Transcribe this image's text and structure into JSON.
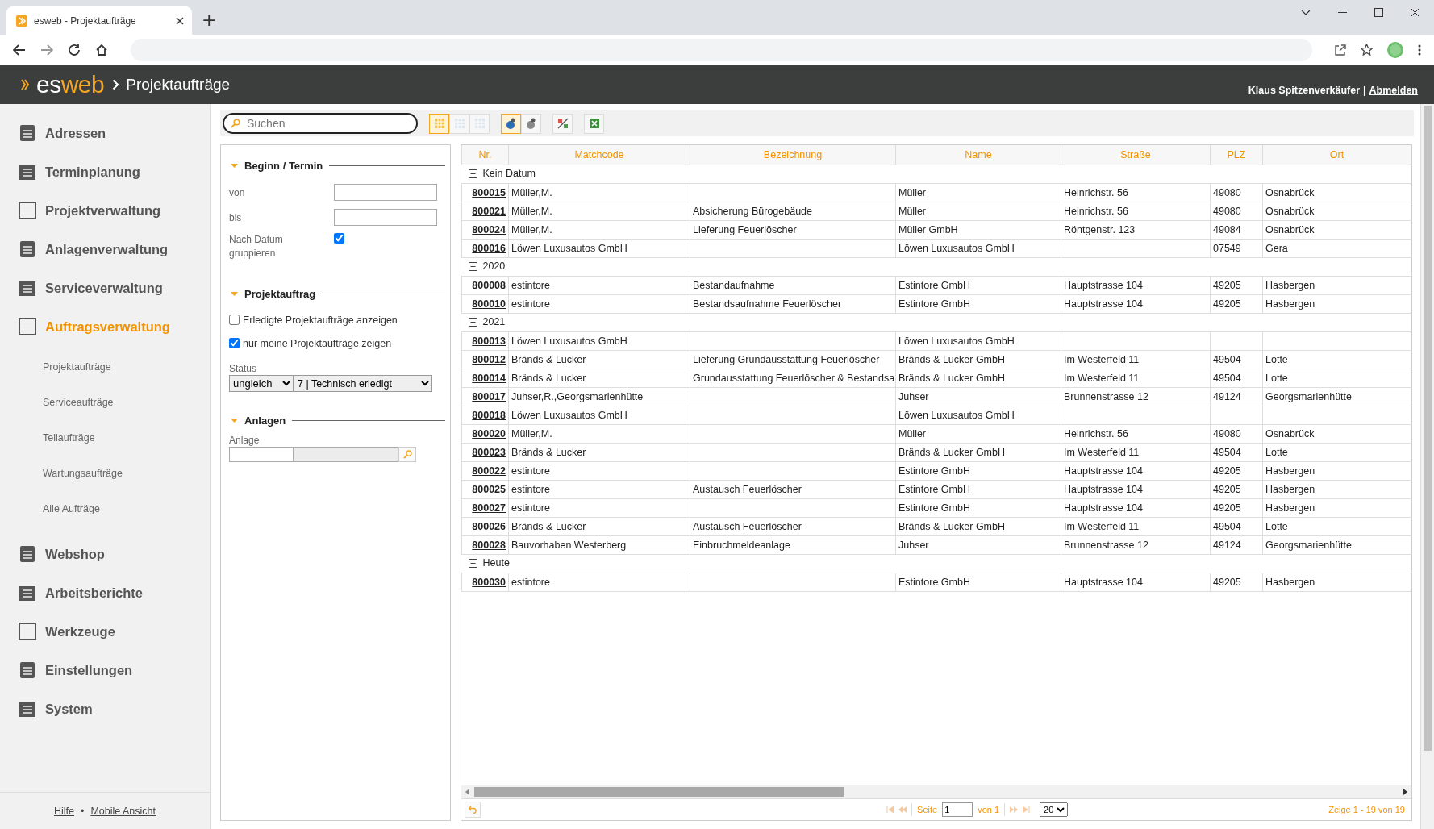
{
  "browser": {
    "tab_title": "esweb - Projektaufträge",
    "new_tab": "+"
  },
  "header": {
    "logo_first": "es",
    "logo_second": "web",
    "page_title": "Projektaufträge",
    "user": "Klaus Spitzenverkäufer",
    "separator": "|",
    "logout": "Abmelden"
  },
  "sidebar": {
    "items": [
      {
        "label": "Adressen",
        "selected": false
      },
      {
        "label": "Terminplanung",
        "selected": false
      },
      {
        "label": "Projektverwaltung",
        "selected": false
      },
      {
        "label": "Anlagenverwaltung",
        "selected": false
      },
      {
        "label": "Serviceverwaltung",
        "selected": false
      },
      {
        "label": "Auftragsverwaltung",
        "selected": true,
        "children": [
          {
            "label": "Projektaufträge",
            "selected": false
          },
          {
            "label": "Serviceaufträge",
            "selected": false
          },
          {
            "label": "Teilaufträge",
            "selected": false
          },
          {
            "label": "Wartungsaufträge",
            "selected": false
          },
          {
            "label": "Alle Aufträge",
            "selected": false
          }
        ]
      },
      {
        "label": "Webshop",
        "selected": false
      },
      {
        "label": "Arbeitsberichte",
        "selected": false
      },
      {
        "label": "Werkzeuge",
        "selected": false
      },
      {
        "label": "Einstellungen",
        "selected": false
      },
      {
        "label": "System",
        "selected": false
      }
    ],
    "footer": {
      "help": "Hilfe",
      "bullet": "•",
      "mobile": "Mobile Ansicht"
    }
  },
  "toolbar": {
    "search": {
      "placeholder": "Suchen"
    },
    "groups": [
      {
        "buttons": [
          {
            "selected": true
          },
          {
            "selected": false
          },
          {
            "selected": false
          }
        ]
      },
      {
        "buttons": [
          {
            "selected": true
          },
          {
            "selected": false
          }
        ]
      },
      {
        "buttons": [
          {
            "selected": false
          }
        ]
      },
      {
        "buttons": [
          {
            "selected": false
          }
        ]
      }
    ]
  },
  "filters": {
    "sections": [
      {
        "title": "Beginn / Termin",
        "expanded": true,
        "fields": [
          {
            "kind": "text",
            "label": "von"
          },
          {
            "kind": "text",
            "label": "bis"
          },
          {
            "kind": "check-right",
            "label": "Nach Datum gruppieren",
            "checked": true
          }
        ]
      },
      {
        "title": "Projektauftrag",
        "expanded": true,
        "fields": [
          {
            "kind": "check",
            "label": "Erledigte Projektaufträge anzeigen",
            "checked": false
          },
          {
            "kind": "check",
            "label": "nur meine Projektaufträge zeigen",
            "checked": true
          },
          {
            "kind": "selects",
            "label": "Status",
            "operator": "ungleich",
            "value": "7 | Technisch erledigt"
          }
        ]
      },
      {
        "title": "Anlagen",
        "expanded": true,
        "fields": [
          {
            "kind": "lookup",
            "label": "Anlage"
          }
        ]
      }
    ]
  },
  "table": {
    "columns": [
      "Nr.",
      "Matchcode",
      "Bezeichnung",
      "Name",
      "Straße",
      "PLZ",
      "Ort"
    ],
    "groups": [
      {
        "label": "Kein Datum",
        "expanded": true,
        "rows": [
          {
            "nr": "800015",
            "matchcode": "Müller,M.",
            "name": "Müller",
            "strasse": "Heinrichstr. 56",
            "plz": "49080",
            "ort": "Osnabrück"
          },
          {
            "nr": "800021",
            "matchcode": "Müller,M.",
            "bezeichnung": "Absicherung Bürogebäude",
            "name": "Müller",
            "strasse": "Heinrichstr. 56",
            "plz": "49080",
            "ort": "Osnabrück"
          },
          {
            "nr": "800024",
            "matchcode": "Müller,M.",
            "bezeichnung": "Lieferung Feuerlöscher",
            "name": "Müller GmbH",
            "strasse": "Röntgenstr. 123",
            "plz": "49084",
            "ort": "Osnabrück"
          },
          {
            "nr": "800016",
            "matchcode": "Löwen Luxusautos GmbH",
            "name": "Löwen Luxusautos GmbH",
            "plz": "07549",
            "ort": "Gera"
          }
        ]
      },
      {
        "label": "2020",
        "expanded": true,
        "rows": [
          {
            "nr": "800008",
            "matchcode": "estintore",
            "bezeichnung": "Bestandaufnahme",
            "name": "Estintore GmbH",
            "strasse": "Hauptstrasse 104",
            "plz": "49205",
            "ort": "Hasbergen"
          },
          {
            "nr": "800010",
            "matchcode": "estintore",
            "bezeichnung": "Bestandsaufnahme Feuerlöscher",
            "name": "Estintore GmbH",
            "strasse": "Hauptstrasse 104",
            "plz": "49205",
            "ort": "Hasbergen"
          }
        ]
      },
      {
        "label": "2021",
        "expanded": true,
        "rows": [
          {
            "nr": "800013",
            "matchcode": "Löwen Luxusautos GmbH",
            "name": "Löwen Luxusautos GmbH"
          },
          {
            "nr": "800012",
            "matchcode": "Bränds & Lucker",
            "bezeichnung": "Lieferung Grundausstattung Feuerlöscher",
            "name": "Bränds & Lucker GmbH",
            "strasse": "Im Westerfeld 11",
            "plz": "49504",
            "ort": "Lotte"
          },
          {
            "nr": "800014",
            "matchcode": "Bränds & Lucker",
            "bezeichnung": "Grundausstattung Feuerlöscher & Bestandsa",
            "name": "Bränds & Lucker GmbH",
            "strasse": "Im Westerfeld 11",
            "plz": "49504",
            "ort": "Lotte"
          },
          {
            "nr": "800017",
            "matchcode": "Juhser,R.,Georgsmarienhütte",
            "name": "Juhser",
            "strasse": "Brunnenstrasse 12",
            "plz": "49124",
            "ort": "Georgsmarienhütte"
          },
          {
            "nr": "800018",
            "matchcode": "Löwen Luxusautos GmbH",
            "name": "Löwen Luxusautos GmbH"
          },
          {
            "nr": "800020",
            "matchcode": "Müller,M.",
            "name": "Müller",
            "strasse": "Heinrichstr. 56",
            "plz": "49080",
            "ort": "Osnabrück"
          },
          {
            "nr": "800023",
            "matchcode": "Bränds & Lucker",
            "name": "Bränds & Lucker GmbH",
            "strasse": "Im Westerfeld 11",
            "plz": "49504",
            "ort": "Lotte"
          },
          {
            "nr": "800022",
            "matchcode": "estintore",
            "name": "Estintore GmbH",
            "strasse": "Hauptstrasse 104",
            "plz": "49205",
            "ort": "Hasbergen"
          },
          {
            "nr": "800025",
            "matchcode": "estintore",
            "bezeichnung": "Austausch Feuerlöscher",
            "name": "Estintore GmbH",
            "strasse": "Hauptstrasse 104",
            "plz": "49205",
            "ort": "Hasbergen"
          },
          {
            "nr": "800027",
            "matchcode": "estintore",
            "name": "Estintore GmbH",
            "strasse": "Hauptstrasse 104",
            "plz": "49205",
            "ort": "Hasbergen"
          },
          {
            "nr": "800026",
            "matchcode": "Bränds & Lucker",
            "bezeichnung": "Austausch Feuerlöscher",
            "name": "Bränds & Lucker GmbH",
            "strasse": "Im Westerfeld 11",
            "plz": "49504",
            "ort": "Lotte"
          },
          {
            "nr": "800028",
            "matchcode": "Bauvorhaben Westerberg",
            "bezeichnung": "Einbruchmeldeanlage",
            "name": "Juhser",
            "strasse": "Brunnenstrasse 12",
            "plz": "49124",
            "ort": "Georgsmarienhütte"
          }
        ]
      },
      {
        "label": "Heute",
        "expanded": true,
        "rows": [
          {
            "nr": "800030",
            "matchcode": "estintore",
            "name": "Estintore GmbH",
            "strasse": "Hauptstrasse 104",
            "plz": "49205",
            "ort": "Hasbergen"
          }
        ]
      }
    ]
  },
  "pager": {
    "page_label": "Seite",
    "page": "1",
    "of": "von 1",
    "page_size": "20",
    "summary": "Zeige 1 - 19 von 19"
  }
}
